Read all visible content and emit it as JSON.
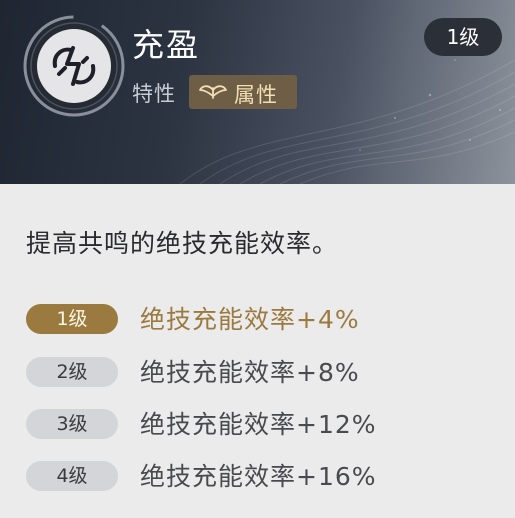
{
  "header": {
    "title": "充盈",
    "trait_label": "特性",
    "trait_badge": "属性",
    "trait_badge_icon": "wings-icon",
    "emblem_icon": "lightning-swirl-icon",
    "level": "1级"
  },
  "description": "提高共鸣的绝技充能效率。",
  "levels": [
    {
      "label": "1级",
      "effect": "绝技充能效率+4%",
      "active": true
    },
    {
      "label": "2级",
      "effect": "绝技充能效率+8%",
      "active": false
    },
    {
      "label": "3级",
      "effect": "绝技充能效率+12%",
      "active": false
    },
    {
      "label": "4级",
      "effect": "绝技充能效率+16%",
      "active": false
    }
  ],
  "colors": {
    "accent_gold": "#9b7a3f",
    "header_dark": "#1f2632",
    "panel_bg": "#ebebec"
  }
}
